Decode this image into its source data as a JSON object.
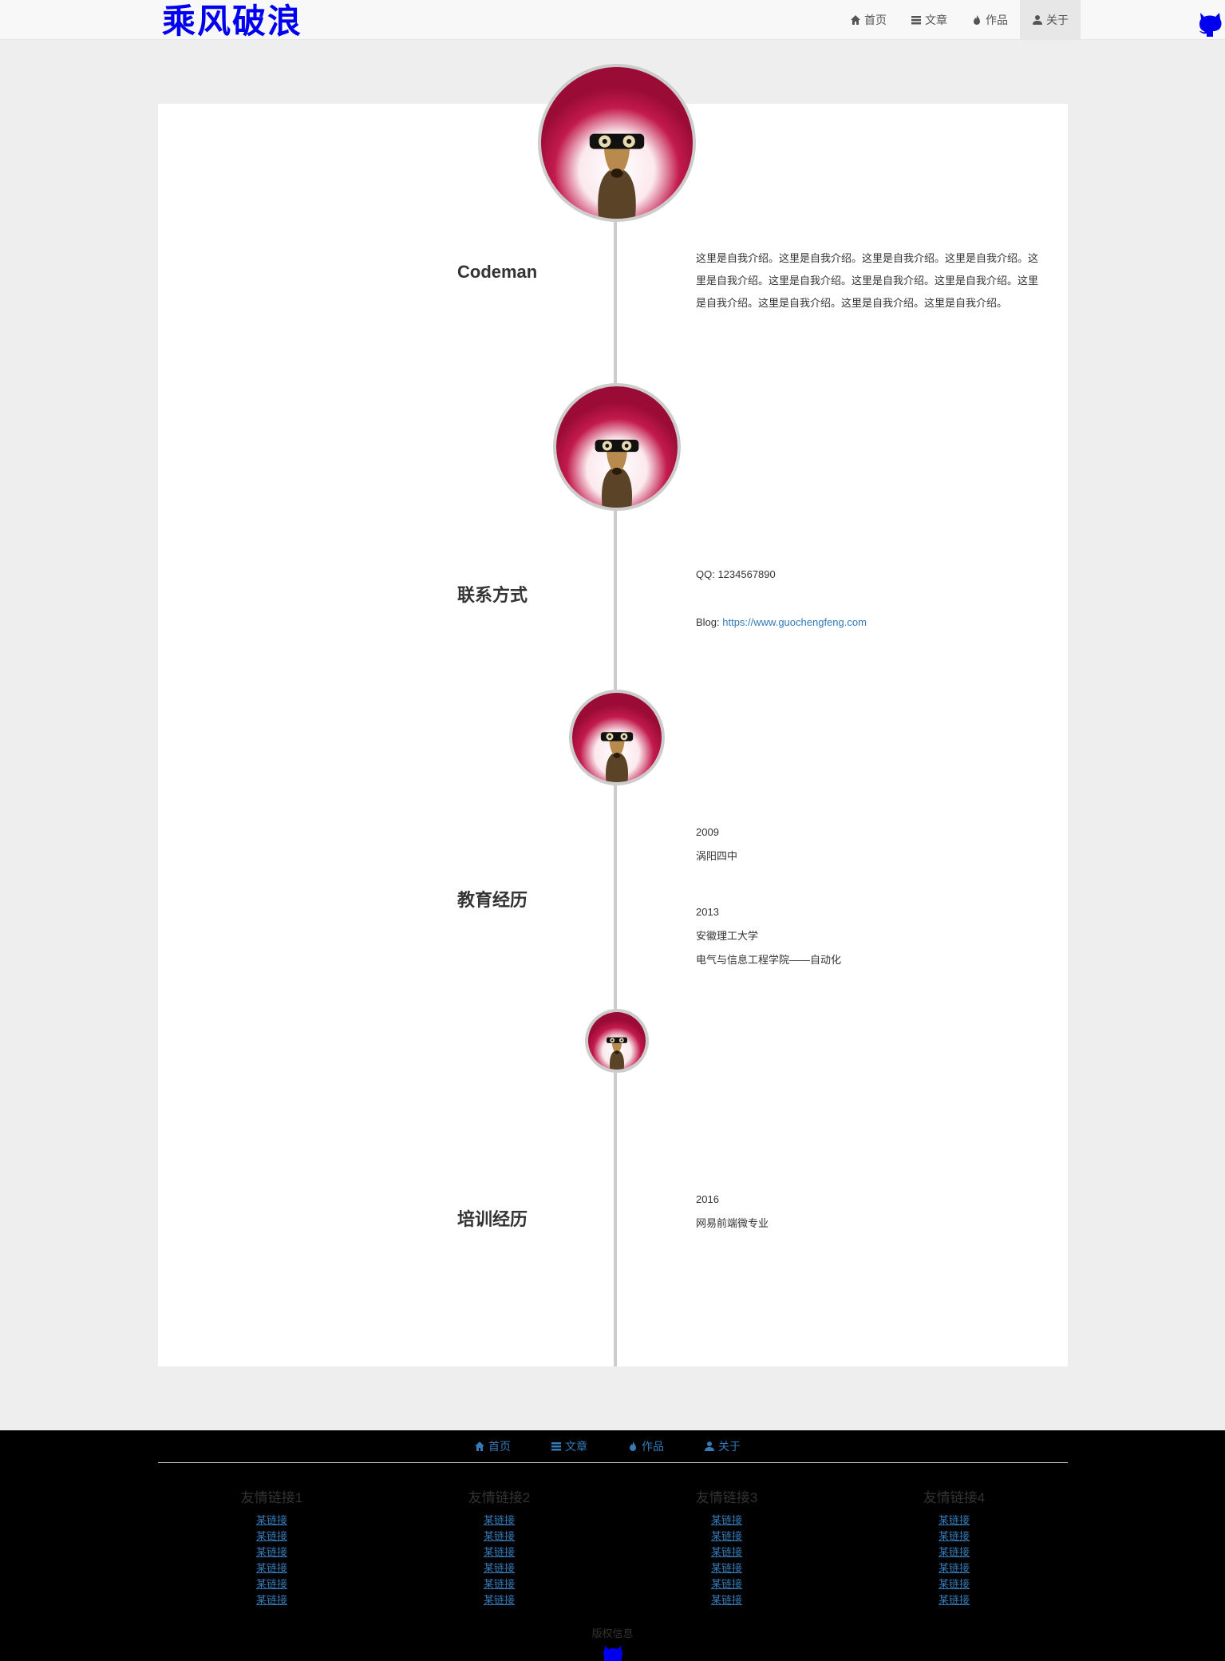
{
  "brand": "乘风破浪",
  "nav": {
    "home": "首页",
    "articles": "文章",
    "works": "作品",
    "about": "关于"
  },
  "sections": {
    "intro": {
      "title": "Codeman",
      "text": "这里是自我介绍。这里是自我介绍。这里是自我介绍。这里是自我介绍。这里是自我介绍。这里是自我介绍。这里是自我介绍。这里是自我介绍。这里是自我介绍。这里是自我介绍。这里是自我介绍。这里是自我介绍。"
    },
    "contact": {
      "title": "联系方式",
      "qq": "QQ: 1234567890",
      "blog_label": "Blog: ",
      "blog_url": "https://www.guochengfeng.com"
    },
    "education": {
      "title": "教育经历",
      "year1": "2009",
      "school1": "涡阳四中",
      "year2": "2013",
      "school2": "安徽理工大学",
      "major2": "电气与信息工程学院——自动化"
    },
    "training": {
      "title": "培训经历",
      "year": "2016",
      "program": "网易前端微专业"
    }
  },
  "footer": {
    "nav": {
      "home": "首页",
      "articles": "文章",
      "works": "作品",
      "about": "关于"
    },
    "columns": [
      {
        "title": "友情链接1",
        "links": [
          "某链接",
          "某链接",
          "某链接",
          "某链接",
          "某链接",
          "某链接"
        ]
      },
      {
        "title": "友情链接2",
        "links": [
          "某链接",
          "某链接",
          "某链接",
          "某链接",
          "某链接",
          "某链接"
        ]
      },
      {
        "title": "友情链接3",
        "links": [
          "某链接",
          "某链接",
          "某链接",
          "某链接",
          "某链接",
          "某链接"
        ]
      },
      {
        "title": "友情链接4",
        "links": [
          "某链接",
          "某链接",
          "某链接",
          "某链接",
          "某链接",
          "某链接"
        ]
      }
    ],
    "copyright": "版权信息"
  },
  "icons": {
    "home": "home-icon",
    "articles": "list-icon",
    "works": "fire-icon",
    "about": "user-icon",
    "github": "github-octocat-icon",
    "avatar": "avatar-sloth-glasses"
  },
  "colors": {
    "brand": "#0000ee",
    "link": "#337ab7",
    "avatar_bg": "#b0103f",
    "timeline": "#cccccc"
  }
}
